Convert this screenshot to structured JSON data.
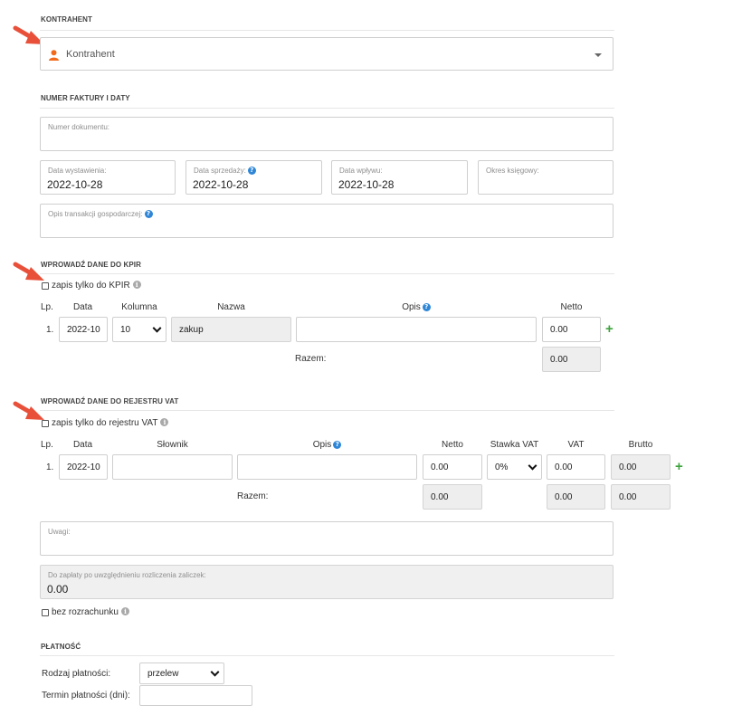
{
  "kontrahent": {
    "section_title": "KONTRAHENT",
    "placeholder": "Kontrahent",
    "icon": "user-icon",
    "accent": "#f26a1b"
  },
  "invoice": {
    "section_title": "NUMER FAKTURY I DATY",
    "numer_label": "Numer dokumentu:",
    "numer_value": "",
    "data_wystawienia_label": "Data wystawienia:",
    "data_wystawienia_value": "2022-10-28",
    "data_sprzedazy_label": "Data sprzedaży:",
    "data_sprzedazy_value": "2022-10-28",
    "data_wplywu_label": "Data wpływu:",
    "data_wplywu_value": "2022-10-28",
    "okres_label": "Okres księgowy:",
    "okres_value": "",
    "opis_label": "Opis transakcji gospodarczej:",
    "opis_value": ""
  },
  "kpir": {
    "section_title": "WPROWADŹ DANE DO KPIR",
    "checkbox_label": "zapis tylko do KPIR",
    "headers": {
      "lp": "Lp.",
      "data": "Data",
      "kolumna": "Kolumna",
      "nazwa": "Nazwa",
      "opis": "Opis",
      "netto": "Netto"
    },
    "row": {
      "lp": "1.",
      "data": "2022-10",
      "kolumna": "10",
      "nazwa": "zakup",
      "opis": "",
      "netto": "0.00"
    },
    "razem_label": "Razem:",
    "razem_netto": "0.00"
  },
  "vat": {
    "section_title": "WPROWADŹ DANE DO REJESTRU VAT",
    "checkbox_label": "zapis tylko do rejestru VAT",
    "headers": {
      "lp": "Lp.",
      "data": "Data",
      "slownik": "Słownik",
      "opis": "Opis",
      "netto": "Netto",
      "stawka": "Stawka VAT",
      "vat": "VAT",
      "brutto": "Brutto"
    },
    "row": {
      "lp": "1.",
      "data": "2022-10",
      "slownik": "",
      "opis": "",
      "netto": "0.00",
      "stawka": "0%",
      "vat": "0.00",
      "brutto": "0.00"
    },
    "razem_label": "Razem:",
    "razem_netto": "0.00",
    "razem_vat": "0.00",
    "razem_brutto": "0.00"
  },
  "uwagi": {
    "label": "Uwagi:",
    "value": ""
  },
  "do_zaplaty": {
    "label": "Do zapłaty po uwzględnieniu rozliczenia zaliczek:",
    "value": "0.00"
  },
  "bez_rozrachunku": {
    "label": "bez rozrachunku"
  },
  "platnosc": {
    "section_title": "PŁATNOŚĆ",
    "rodzaj_label": "Rodzaj płatności:",
    "rodzaj_value": "przelew",
    "termin_label": "Termin płatności (dni):",
    "termin_value": ""
  },
  "colors": {
    "help_blue": "#2f86d6",
    "add_green": "#3da33d",
    "pointer_red": "#e8503a"
  }
}
